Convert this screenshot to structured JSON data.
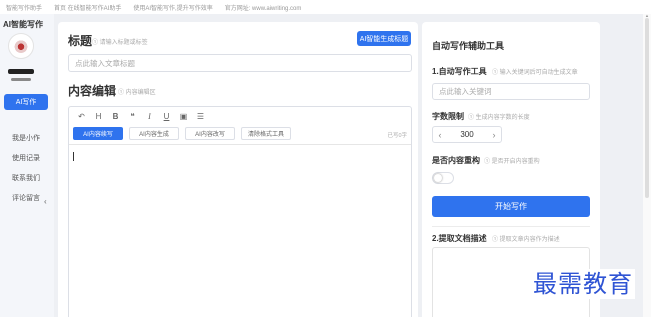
{
  "topbar": {
    "items": [
      "智能写作助手",
      "首页 在线智能写作AI助手",
      "使用AI智能写作,提升写作效率",
      "官方网址: www.aiwriting.com"
    ]
  },
  "sidebar": {
    "logo": "AI智能写作",
    "items": [
      "AI写作",
      "我是小作",
      "使用记录",
      "联系我们",
      "评论留言"
    ],
    "active_index": 0,
    "collapse_icon": "chevron-left-icon"
  },
  "main": {
    "title_heading": "标题",
    "title_hint": "① 请输入标题或标签",
    "ai_button": "AI智能生成标题",
    "title_placeholder": "点此输入文章标题",
    "content_heading": "内容编辑",
    "content_hint": "① 内容编辑区",
    "toolbar_icons": [
      "undo-icon",
      "heading-icon",
      "bold-icon",
      "quote-icon",
      "italic-icon",
      "underline-icon",
      "image-icon",
      "list-icon"
    ],
    "toolbar_glyphs": [
      "↶",
      "H",
      "B",
      "❝",
      "I",
      "U",
      "▣",
      "☰"
    ],
    "editor_buttons": [
      "AI内容续写",
      "AI内容生成",
      "AI内容改写",
      "清除格式工具"
    ],
    "editor_button_active": 0,
    "word_count": "已写0字"
  },
  "tools": {
    "title": "自动写作辅助工具",
    "section1_label": "1.自动写作工具",
    "section1_hint": "① 输入关键词后可自动生成文章",
    "keyword_placeholder": "点此输入关键词",
    "word_limit_label": "字数限制",
    "word_limit_hint": "① 生成内容字数的长度",
    "word_limit_value": "300",
    "stepper_minus": "‹",
    "stepper_plus": "›",
    "rewrite_label": "是否内容重构",
    "rewrite_hint": "① 是否开启内容重构",
    "rewrite_enabled": false,
    "start_button": "开始写作",
    "section2_label": "2.提取文档描述",
    "section2_hint": "① 提取文章内容作为描述"
  },
  "watermark": "最需教育",
  "colors": {
    "accent": "#2f73ee",
    "watermark": "#2f54d4"
  }
}
